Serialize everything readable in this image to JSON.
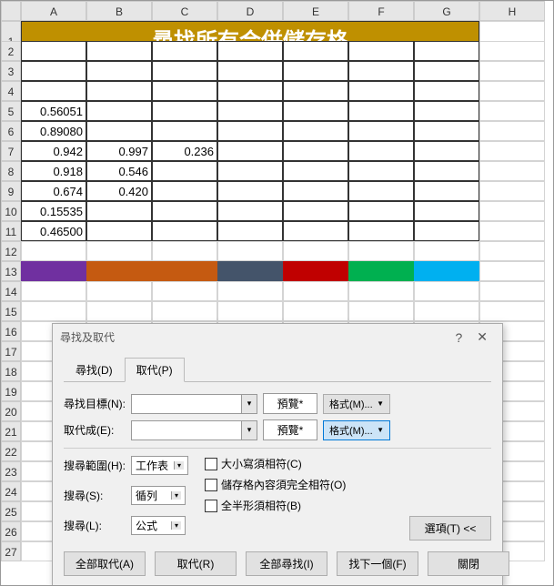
{
  "columns": [
    "A",
    "B",
    "C",
    "D",
    "E",
    "F",
    "G",
    "H"
  ],
  "rows": [
    "1",
    "2",
    "3",
    "4",
    "5",
    "6",
    "7",
    "8",
    "9",
    "10",
    "11",
    "12",
    "13",
    "14",
    "15",
    "16",
    "17",
    "18",
    "19",
    "20",
    "21",
    "22",
    "23",
    "24",
    "25",
    "26",
    "27"
  ],
  "title_merged": "尋找所有合併儲存格",
  "cells": {
    "A5": "0.56051",
    "A6": "0.89080",
    "A7": "0.942",
    "B7": "0.997",
    "C7": "0.236",
    "A8": "0.918",
    "B8": "0.546",
    "A9": "0.674",
    "B9": "0.420",
    "A10": "0.15535",
    "A11": "0.46500"
  },
  "color_bar": [
    "#7030a0",
    "#c55a11",
    "#c55a11",
    "#44546a",
    "#c00000",
    "#00b050",
    "#00b0f0"
  ],
  "dlg": {
    "title": "尋找及取代",
    "help": "?",
    "tabs": {
      "find": "尋找(D)",
      "replace": "取代(P)"
    },
    "labels": {
      "find_what": "尋找目標(N):",
      "replace_with": "取代成(E):",
      "within": "搜尋範圍(H):",
      "search": "搜尋(S):",
      "lookin": "搜尋(L):",
      "preview": "預覽*",
      "format": "格式(M)...",
      "within_val": "工作表",
      "search_val": "循列",
      "lookin_val": "公式",
      "match_case": "大小寫須相符(C)",
      "match_entire": "儲存格內容須完全相符(O)",
      "match_byte": "全半形須相符(B)",
      "options": "選項(T) <<"
    },
    "buttons": {
      "replace_all": "全部取代(A)",
      "replace": "取代(R)",
      "find_all": "全部尋找(I)",
      "find_next": "找下一個(F)",
      "close": "關閉"
    }
  }
}
